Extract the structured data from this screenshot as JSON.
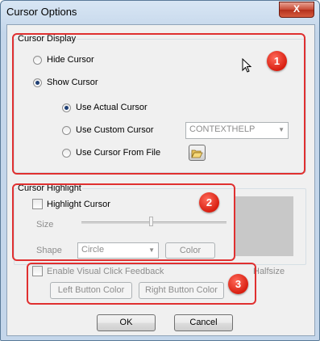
{
  "window": {
    "title": "Cursor Options",
    "close_glyph": "X"
  },
  "cursor_display": {
    "group_label": "Cursor Display",
    "hide_cursor": {
      "label": "Hide Cursor",
      "selected": false
    },
    "show_cursor": {
      "label": "Show Cursor",
      "selected": true
    },
    "use_actual": {
      "label": "Use Actual Cursor",
      "selected": true
    },
    "use_custom": {
      "label": "Use Custom Cursor",
      "selected": false
    },
    "custom_combo_value": "CONTEXTHELP",
    "use_file": {
      "label": "Use Cursor From File",
      "selected": false
    }
  },
  "cursor_highlight": {
    "group_label": "Cursor Highlight",
    "highlight_label": "Highlight Cursor",
    "size_label": "Size",
    "shape_label": "Shape",
    "shape_value": "Circle",
    "color_button": "Color",
    "partial_label": "Halfsize"
  },
  "click_feedback": {
    "enable_label": "Enable Visual Click Feedback",
    "left_button": "Left Button Color",
    "right_button": "Right Button Color"
  },
  "buttons": {
    "ok": "OK",
    "cancel": "Cancel"
  },
  "badges": [
    "1",
    "2",
    "3"
  ],
  "colors": {
    "annotation_red": "#e03030",
    "badge_red": "#d81e10"
  }
}
